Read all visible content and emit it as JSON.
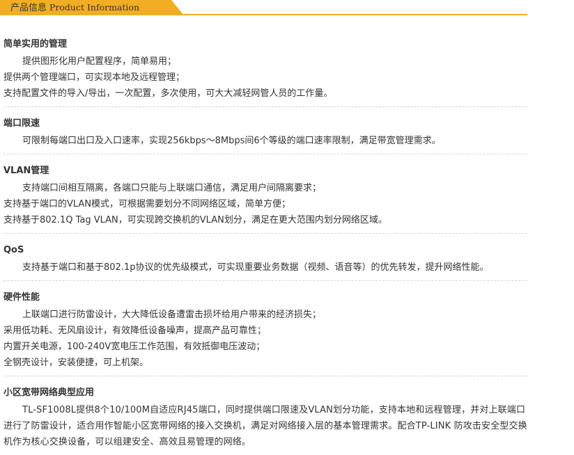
{
  "header": {
    "tab_title_cn": "产品信息",
    "tab_title_en": "Product Information"
  },
  "colors": {
    "accent": "#f2ae22",
    "text": "#333333",
    "divider": "#d6d6d6"
  },
  "sections": [
    {
      "title": "简单实用的管理",
      "lines": [
        "提供图形化用户配置程序，简单易用；",
        "提供两个管理端口，可实现本地及远程管理；",
        "支持配置文件的导入/导出，一次配置，多次使用，可大大减轻网管人员的工作量。"
      ]
    },
    {
      "title": "端口限速",
      "lines": [
        "可限制每端口出口及入口速率，实现256kbps～8Mbps间6个等级的端口速率限制，满足带宽管理需求。"
      ]
    },
    {
      "title": "VLAN管理",
      "lines": [
        "支持端口间相互隔离，各端口只能与上联端口通信，满足用户间隔离要求；",
        "支持基于端口的VLAN模式，可根据需要划分不同网络区域，简单方便；",
        "支持基于802.1Q Tag VLAN，可实现跨交换机的VLAN划分，满足在更大范围内划分网络区域。"
      ]
    },
    {
      "title": "QoS",
      "lines": [
        "支持基于端口和基于802.1p协议的优先级模式，可实现重要业务数据（视频、语音等）的优先转发，提升网络性能。"
      ]
    },
    {
      "title": "硬件性能",
      "lines": [
        "上联端口进行防雷设计，大大降低设备遭雷击损坏给用户带来的经济损失；",
        "采用低功耗、无风扇设计，有效降低设备噪声，提高产品可靠性；",
        "内置开关电源，100-240V宽电压工作范围，有效抵御电压波动；",
        "全钢壳设计，安装便捷，可上机架。"
      ]
    },
    {
      "title": "小区宽带网络典型应用",
      "paragraph": "TL-SF1008L提供8个10/100M自适应RJ45端口，同时提供端口限速及VLAN划分功能，支持本地和远程管理，并对上联端口进行了防雷设计，适合用作智能小区宽带网络的接入交换机，满足对网络接入层的基本管理需求。配合TP-LINK 防攻击安全型交换机作为核心交换设备，可以组建安全、高效且易管理的网络。"
    }
  ]
}
